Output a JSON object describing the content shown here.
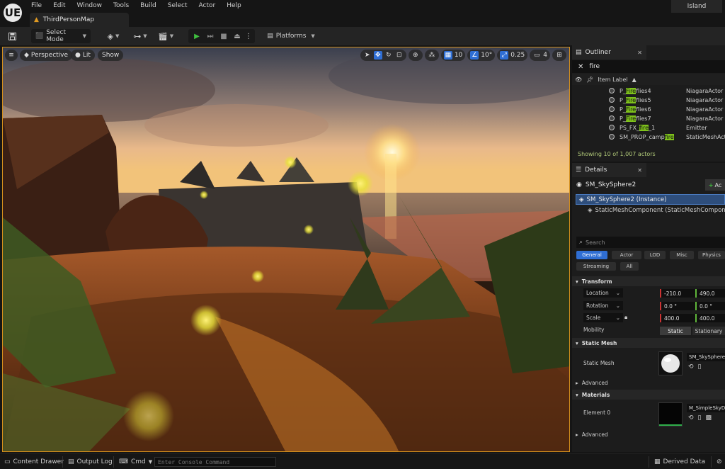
{
  "app": {
    "logo": "UE",
    "project": "Island"
  },
  "menu": [
    "File",
    "Edit",
    "Window",
    "Tools",
    "Build",
    "Select",
    "Actor",
    "Help"
  ],
  "tab": {
    "label": "ThirdPersonMap"
  },
  "toolbar": {
    "select_mode": "Select Mode",
    "platforms": "Platforms"
  },
  "viewport": {
    "perspective": "Perspective",
    "lit": "Lit",
    "show": "Show",
    "grid_snap": "10",
    "rotation_snap": "10°",
    "scale_snap": "0.25",
    "camera_speed": "4"
  },
  "outliner": {
    "title": "Outliner",
    "search_value": "fire",
    "column_label": "Item Label",
    "rows": [
      {
        "pre": "P_",
        "hl": "Fire",
        "post": "flies4",
        "type": "NiagaraActor"
      },
      {
        "pre": "P_",
        "hl": "Fire",
        "post": "flies5",
        "type": "NiagaraActor"
      },
      {
        "pre": "P_",
        "hl": "Fire",
        "post": "flies6",
        "type": "NiagaraActor"
      },
      {
        "pre": "P_",
        "hl": "Fire",
        "post": "flies7",
        "type": "NiagaraActor"
      },
      {
        "pre": "PS_FX_",
        "hl": "fire",
        "post": "_1",
        "type": "Emitter"
      },
      {
        "pre": "SM_PROP_camp",
        "hl": "fire",
        "post": "",
        "type": "StaticMeshActor"
      }
    ],
    "footer": "Showing 10 of 1,007 actors"
  },
  "details": {
    "title": "Details",
    "actor_name": "SM_SkySphere2",
    "add_label": "Ac",
    "instance_label": "SM_SkySphere2 (Instance)",
    "component_label": "StaticMeshComponent (StaticMeshComponen",
    "search_placeholder": "Search",
    "filters": [
      "General",
      "Actor",
      "LOD",
      "Misc",
      "Physics",
      "Streaming",
      "All"
    ],
    "transform": {
      "header": "Transform",
      "location_label": "Location",
      "rotation_label": "Rotation",
      "scale_label": "Scale",
      "location": [
        "-210.0",
        "490.0"
      ],
      "rotation": [
        "0.0 °",
        "0.0 °"
      ],
      "scale": [
        "400.0",
        "400.0"
      ],
      "mobility_label": "Mobility",
      "mobility_options": [
        "Static",
        "Stationary"
      ]
    },
    "static_mesh": {
      "header": "Static Mesh",
      "label": "Static Mesh",
      "asset": "SM_SkySphere",
      "advanced": "Advanced"
    },
    "materials": {
      "header": "Materials",
      "label": "Element 0",
      "asset": "M_SimpleSkyDo",
      "advanced": "Advanced"
    }
  },
  "statusbar": {
    "content_drawer": "Content Drawer",
    "output_log": "Output Log",
    "cmd": "Cmd",
    "console_placeholder": "Enter Console Command",
    "derived_data": "Derived Data"
  },
  "colors": {
    "accent": "#2f6ed3",
    "viewport_border": "#d48f1c",
    "search_highlight": "#7fc21c",
    "play": "#3fbf3f"
  }
}
